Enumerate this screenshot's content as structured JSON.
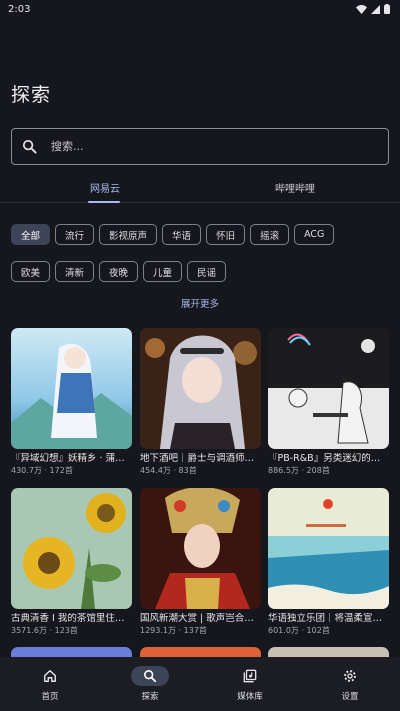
{
  "status": {
    "time": "2:03"
  },
  "page": {
    "title": "探索"
  },
  "search": {
    "placeholder": "搜索..."
  },
  "tabs": [
    {
      "label": "网易云",
      "active": true
    },
    {
      "label": "哔哩哔哩",
      "active": false
    }
  ],
  "categories": {
    "row1": [
      "全部",
      "流行",
      "影视原声",
      "华语",
      "怀旧",
      "摇滚",
      "ACG"
    ],
    "row2": [
      "欧美",
      "清新",
      "夜晚",
      "儿童",
      "民谣"
    ],
    "selected": "全部"
  },
  "expand_label": "展开更多",
  "playlists": [
    {
      "title": "『异域幻想』妖精乡 · 蒲公英的旅途",
      "plays": "430.7万",
      "tracks": "172首"
    },
    {
      "title": "地下酒吧｜爵士与调酒师的夜晚",
      "plays": "454.4万",
      "tracks": "83首"
    },
    {
      "title": "『PB-R&B』另类迷幻的微醺夜",
      "plays": "886.5万",
      "tracks": "208首"
    },
    {
      "title": "古典清香 I 我的茶馆里住着莫扎特",
      "plays": "3571.6万",
      "tracks": "123首"
    },
    {
      "title": "国风新潮大赏 | 歌声岂合天地间",
      "plays": "1293.1万",
      "tracks": "137首"
    },
    {
      "title": "华语独立乐团｜将温柔宣泄给世界",
      "plays": "601.0万",
      "tracks": "102首"
    }
  ],
  "nav": [
    {
      "label": "首页",
      "icon": "home-icon",
      "active": false
    },
    {
      "label": "探索",
      "icon": "search-icon",
      "active": true
    },
    {
      "label": "媒体库",
      "icon": "library-icon",
      "active": false
    },
    {
      "label": "设置",
      "icon": "settings-icon",
      "active": false
    }
  ],
  "colors": {
    "background": "#16171c",
    "accent": "#a7b9f0",
    "selected_chip": "#3c4458",
    "nav_background": "#1c1d23"
  }
}
